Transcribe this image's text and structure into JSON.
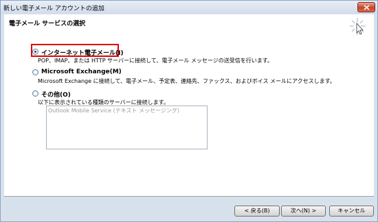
{
  "window": {
    "title": "新しい電子メール アカウントの追加"
  },
  "header": {
    "title": "電子メール サービスの選択"
  },
  "options": [
    {
      "label": "インターネット電子メール(I)",
      "description": "POP、IMAP、または HTTP サーバーに接続して、電子メール メッセージの送受信を行います。",
      "selected": true
    },
    {
      "label": "Microsoft Exchange(M)",
      "description": "Microsoft Exchange に接続して、電子メール、予定表、連絡先、ファックス、およびボイス メールにアクセスします。",
      "selected": false
    },
    {
      "label": "その他(O)",
      "description": "以下に表示されている種類のサーバーに接続します。",
      "selected": false
    }
  ],
  "other_list": {
    "items": [
      "Outlook Mobile Service (テキスト メッセージング)"
    ]
  },
  "buttons": {
    "back": "< 戻る(B)",
    "next": "次へ(N) >",
    "cancel": "キャンセル"
  },
  "colors": {
    "highlight_border": "#e00000",
    "close_button": "#c7442a"
  }
}
